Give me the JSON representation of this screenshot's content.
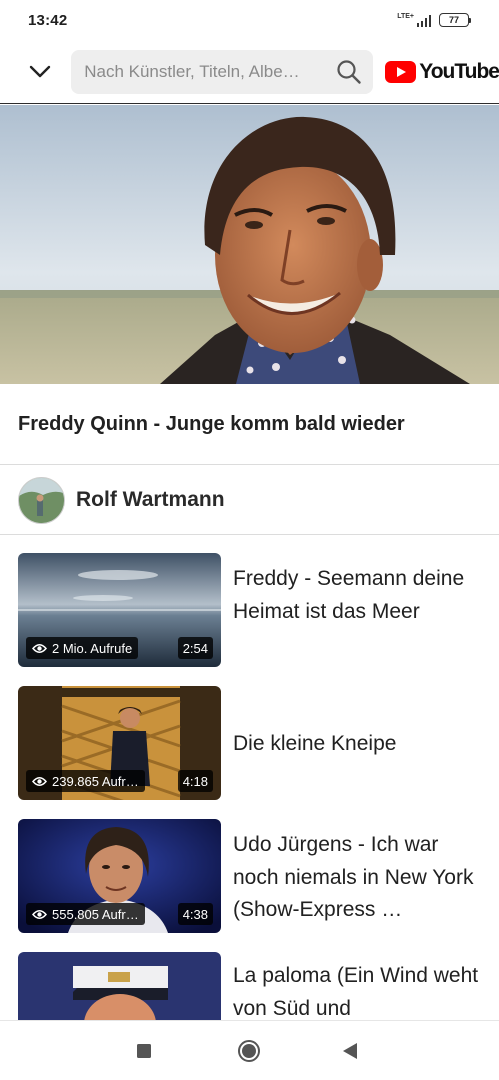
{
  "status_bar": {
    "time": "13:42",
    "network": "LTE+",
    "battery": "77"
  },
  "top_bar": {
    "search_placeholder": "Nach Künstler, Titeln, Albe…",
    "logo_text": "YouTube"
  },
  "now_playing": {
    "title": "Freddy Quinn - Junge komm bald wieder"
  },
  "channel": {
    "name": "Rolf Wartmann"
  },
  "related_videos": [
    {
      "title": "Freddy - Seemann deine Heimat ist das Meer",
      "views": "2 Mio. Aufrufe",
      "duration": "2:54"
    },
    {
      "title": "Die kleine Kneipe",
      "views": "239.865 Aufr…",
      "duration": "4:18"
    },
    {
      "title": "Udo Jürgens - Ich war noch niemals in New York (Show-Express …",
      "views": "555.805 Aufr…",
      "duration": "4:38"
    },
    {
      "title": "La paloma (Ein Wind weht von Süd und",
      "views": "",
      "duration": ""
    }
  ],
  "icons": {
    "collapse": "chevron-down-icon",
    "search": "search-icon",
    "logo": "youtube-logo-icon",
    "views": "eye-icon",
    "nav_recents": "square-icon",
    "nav_home": "circle-icon",
    "nav_back": "triangle-back-icon"
  },
  "colors": {
    "brand_red": "#ff0000",
    "badge_bg": "#000000",
    "search_bg": "#eeeeee"
  }
}
